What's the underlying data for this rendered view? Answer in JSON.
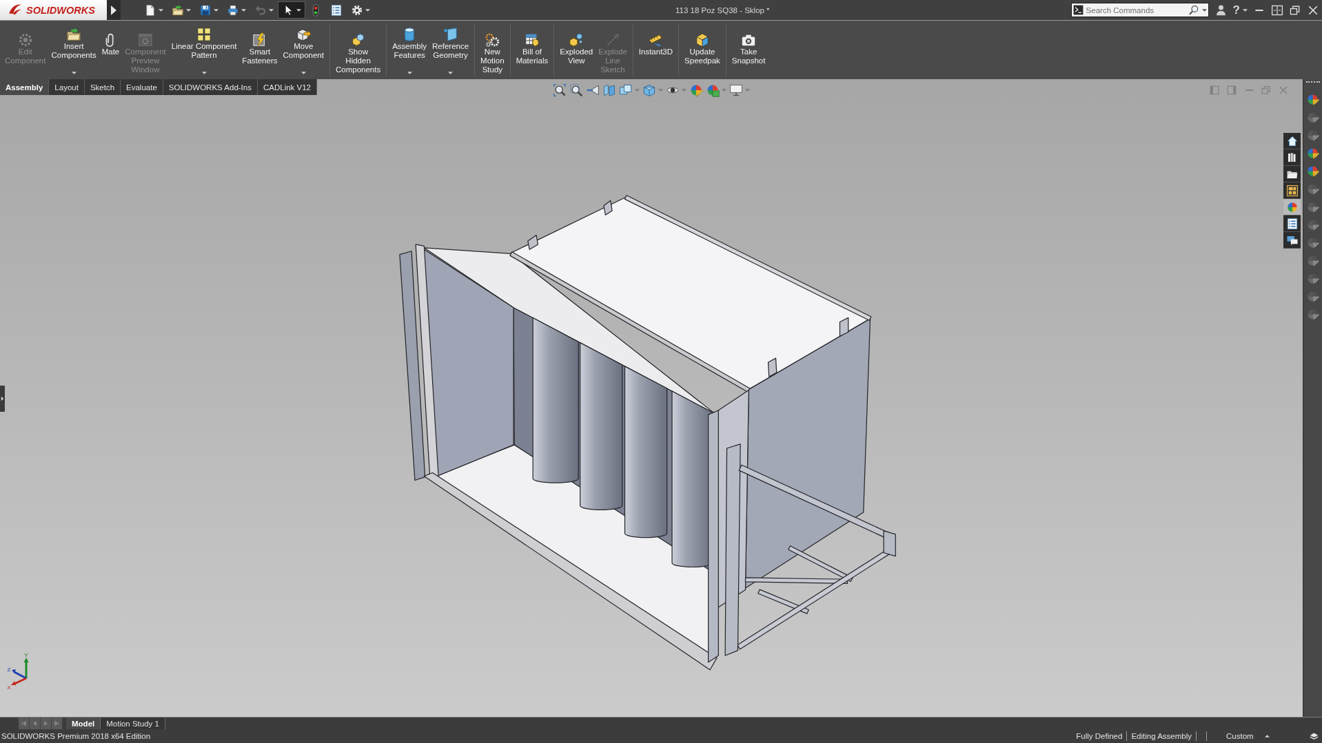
{
  "window": {
    "app_name": "SOLIDWORKS",
    "title": "113 18 Poz SQ38 - Sklop *",
    "help": "?"
  },
  "quick_access": [
    {
      "kind": "new",
      "has_menu": true,
      "disabled": false,
      "on": false
    },
    {
      "kind": "open",
      "has_menu": true,
      "disabled": false,
      "on": false
    },
    {
      "kind": "save",
      "has_menu": true,
      "disabled": false,
      "on": false
    },
    {
      "kind": "print",
      "has_menu": true,
      "disabled": false,
      "on": false
    },
    {
      "kind": "undo",
      "has_menu": true,
      "disabled": true,
      "on": false
    },
    {
      "kind": "select",
      "has_menu": true,
      "disabled": false,
      "on": true
    },
    {
      "kind": "rebuild",
      "has_menu": false,
      "disabled": false,
      "on": false
    },
    {
      "kind": "file_properties",
      "has_menu": false,
      "disabled": false,
      "on": false
    },
    {
      "kind": "options",
      "has_menu": true,
      "disabled": false,
      "on": false
    }
  ],
  "search": {
    "placeholder": "Search Commands"
  },
  "command_manager": {
    "groups": [
      [
        {
          "kind": "edit_component",
          "label": "Edit\nComponent",
          "disabled": true,
          "has_menu": false
        },
        {
          "kind": "insert_components",
          "label": "Insert\nComponents",
          "disabled": false,
          "has_menu": true
        },
        {
          "kind": "mate",
          "label": "Mate",
          "disabled": false,
          "has_menu": false
        },
        {
          "kind": "component_preview_window",
          "label": "Component\nPreview\nWindow",
          "disabled": true,
          "has_menu": false
        },
        {
          "kind": "linear_component_pattern",
          "label": "Linear Component\nPattern",
          "disabled": false,
          "has_menu": true
        },
        {
          "kind": "smart_fasteners",
          "label": "Smart\nFasteners",
          "disabled": false,
          "has_menu": false
        },
        {
          "kind": "move_component",
          "label": "Move\nComponent",
          "disabled": false,
          "has_menu": true
        }
      ],
      [
        {
          "kind": "show_hidden_components",
          "label": "Show\nHidden\nComponents",
          "disabled": false,
          "has_menu": false
        }
      ],
      [
        {
          "kind": "assembly_features",
          "label": "Assembly\nFeatures",
          "disabled": false,
          "has_menu": true
        },
        {
          "kind": "reference_geometry",
          "label": "Reference\nGeometry",
          "disabled": false,
          "has_menu": true
        }
      ],
      [
        {
          "kind": "new_motion_study",
          "label": "New\nMotion\nStudy",
          "disabled": false,
          "has_menu": false
        }
      ],
      [
        {
          "kind": "bill_of_materials",
          "label": "Bill of\nMaterials",
          "disabled": false,
          "has_menu": false
        }
      ],
      [
        {
          "kind": "exploded_view",
          "label": "Exploded\nView",
          "disabled": false,
          "has_menu": false
        },
        {
          "kind": "explode_line_sketch",
          "label": "Explode\nLine\nSketch",
          "disabled": true,
          "has_menu": false
        }
      ],
      [
        {
          "kind": "instant3d",
          "label": "Instant3D",
          "disabled": false,
          "has_menu": false
        }
      ],
      [
        {
          "kind": "update_speedpak",
          "label": "Update\nSpeedpak",
          "disabled": false,
          "has_menu": false
        }
      ],
      [
        {
          "kind": "take_snapshot",
          "label": "Take\nSnapshot",
          "disabled": false,
          "has_menu": false
        }
      ]
    ]
  },
  "tabs": [
    {
      "label": "Assembly",
      "selected": true
    },
    {
      "label": "Layout",
      "selected": false
    },
    {
      "label": "Sketch",
      "selected": false
    },
    {
      "label": "Evaluate",
      "selected": false
    },
    {
      "label": "SOLIDWORKS Add-Ins",
      "selected": false
    },
    {
      "label": "CADLink V12",
      "selected": false
    }
  ],
  "task_pane_tabs": [
    {
      "kind": "home",
      "selected": false
    },
    {
      "kind": "design_library",
      "selected": false
    },
    {
      "kind": "file_explorer",
      "selected": false
    },
    {
      "kind": "view_palette",
      "selected": false
    },
    {
      "kind": "appearances",
      "selected": true
    },
    {
      "kind": "custom_properties",
      "selected": false
    },
    {
      "kind": "forum",
      "selected": false
    }
  ],
  "display_pane": [
    {
      "disabled": false
    },
    {
      "disabled": true
    },
    {
      "disabled": true
    },
    {
      "disabled": false
    },
    {
      "disabled": false
    },
    {
      "disabled": true
    },
    {
      "disabled": true
    },
    {
      "disabled": true
    },
    {
      "disabled": true
    },
    {
      "disabled": true
    },
    {
      "disabled": true
    },
    {
      "disabled": true
    },
    {
      "disabled": true
    }
  ],
  "triad": {
    "x": "X",
    "y": "Y",
    "z": "Z"
  },
  "model_tabs": [
    {
      "label": "Model",
      "selected": true
    },
    {
      "label": "Motion Study 1",
      "selected": false
    }
  ],
  "status_bar": {
    "product": "SOLIDWORKS Premium 2018 x64 Edition",
    "state": "Fully Defined",
    "mode": "Editing Assembly",
    "units": "Custom"
  }
}
